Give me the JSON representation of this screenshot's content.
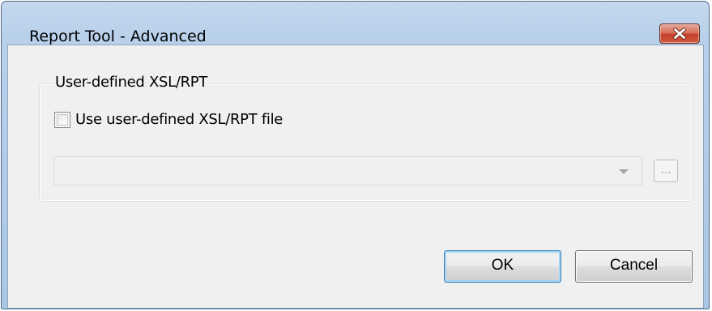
{
  "window": {
    "title": "Report Tool - Advanced",
    "close_symbol": "×"
  },
  "group": {
    "label": "User-defined XSL/RPT",
    "checkbox": {
      "label": "Use user-defined XSL/RPT file",
      "checked": false
    },
    "file_combo": {
      "value": ""
    },
    "browse_label": "..."
  },
  "buttons": {
    "ok_label": "OK",
    "cancel_label": "Cancel"
  },
  "icons": {
    "close": "close-icon",
    "dropdown": "chevron-down-icon"
  },
  "colors": {
    "titlebar": "#b9d0ea",
    "close_button": "#c2402a",
    "dialog_background": "#f0f0f0",
    "default_button_border": "#3c7fb1"
  }
}
